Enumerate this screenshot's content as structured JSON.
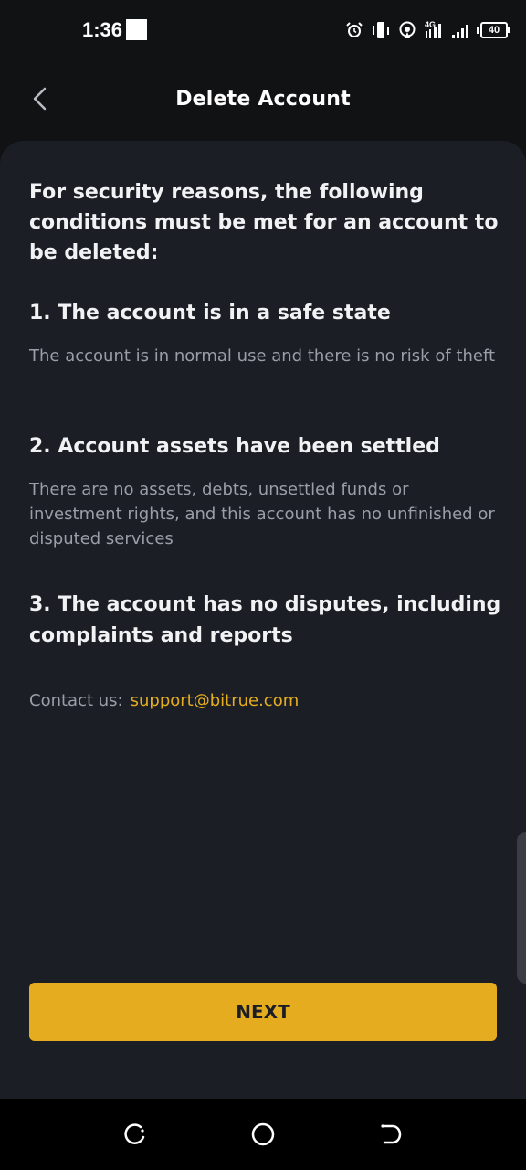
{
  "status_bar": {
    "time": "1:36",
    "signal": "4G",
    "battery": "40",
    "icons": [
      "alarm-icon",
      "vibrate-icon",
      "hotspot-icon",
      "signal-4g-icon",
      "signal-bars-icon",
      "battery-icon"
    ]
  },
  "header": {
    "title": "Delete Account",
    "back_icon": "chevron-left-icon"
  },
  "content": {
    "intro": "For security reasons, the following conditions must be met for an account to be deleted:",
    "conditions": [
      {
        "title": "1. The account is in a safe state",
        "description": "The account is in normal use and there is no risk of theft"
      },
      {
        "title": "2. Account assets have been settled",
        "description": "There are no assets, debts, unsettled funds or investment rights, and this account has no unfinished or disputed services"
      },
      {
        "title": "3. The account has no disputes, including complaints and reports",
        "description": ""
      }
    ],
    "contact_label": "Contact us:",
    "contact_email": "support@bitrue.com"
  },
  "actions": {
    "next_label": "NEXT"
  },
  "nav_bar": {
    "icons": [
      "recents-icon",
      "home-icon",
      "back-icon"
    ]
  },
  "colors": {
    "background": "#111214",
    "card": "#1b1e25",
    "accent": "#e5ac20",
    "primary_text": "#f1f2f4",
    "secondary_text": "#9a9ea7"
  }
}
